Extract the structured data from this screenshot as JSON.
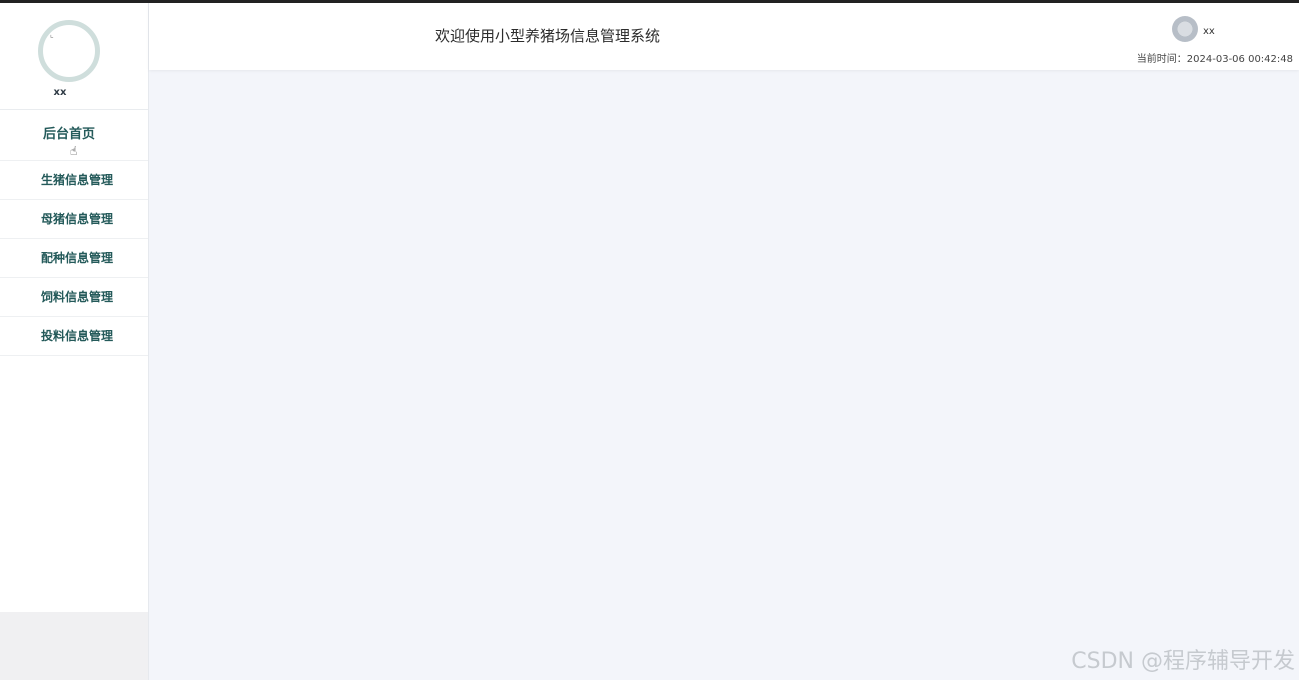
{
  "header": {
    "title": "欢迎使用小型养猪场信息管理系统",
    "username": "xx",
    "time_label": "当前时间：",
    "time_value": "2024-03-06 00:42:48"
  },
  "sidebar": {
    "username": "xx",
    "home_label": "后台首页",
    "items": [
      {
        "label": "生猪信息管理"
      },
      {
        "label": "母猪信息管理"
      },
      {
        "label": "配种信息管理"
      },
      {
        "label": "饲料信息管理"
      },
      {
        "label": "投料信息管理"
      }
    ]
  },
  "watermark": "CSDN @程序辅导开发",
  "colors": {
    "menu_text": "#245a5a",
    "avatar_ring": "#cfdedc",
    "content_bg": "#f3f5fa"
  }
}
